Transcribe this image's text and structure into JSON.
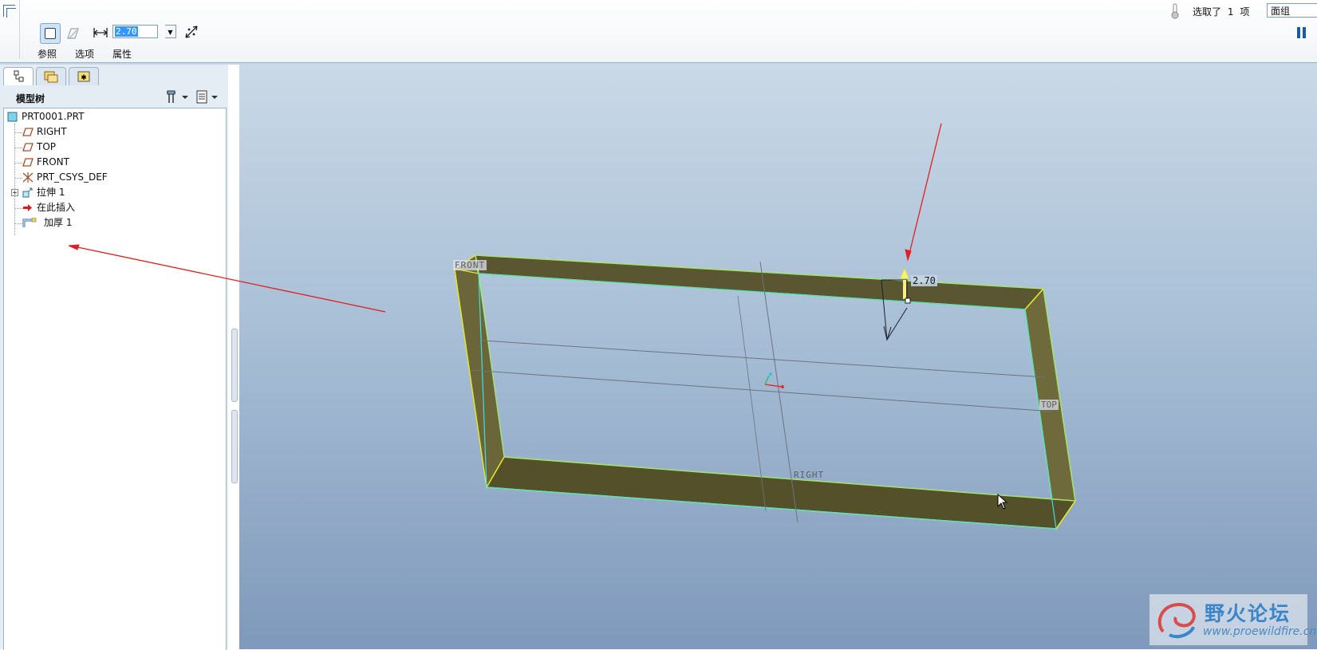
{
  "dashboard": {
    "thickness_value": "2.70",
    "tabs": [
      "参照",
      "选项",
      "属性"
    ],
    "status_prefix": "选取了",
    "status_count": "1",
    "status_suffix": "项",
    "filter_value": "面组"
  },
  "navigator": {
    "model_tree_title": "模型树",
    "items": [
      {
        "label": "PRT0001.PRT",
        "icon": "part-icon"
      },
      {
        "label": "RIGHT",
        "icon": "datum-plane-icon"
      },
      {
        "label": "TOP",
        "icon": "datum-plane-icon"
      },
      {
        "label": "FRONT",
        "icon": "datum-plane-icon"
      },
      {
        "label": "PRT_CSYS_DEF",
        "icon": "csys-icon"
      },
      {
        "label": "拉伸 1",
        "icon": "extrude-icon"
      },
      {
        "label": "在此插入",
        "icon": "insert-here-arrow-icon"
      },
      {
        "label": "加厚 1",
        "icon": "thicken-icon"
      }
    ]
  },
  "viewport": {
    "datum_labels": {
      "front": "FRONT",
      "top": "TOP",
      "right": "RIGHT"
    },
    "thickness_dimension": "2.70"
  },
  "watermark": {
    "title": "野火论坛",
    "url": "www.proewildfire.cn"
  },
  "colors": {
    "background_top": "#cad9e7",
    "background_bottom": "#7f99bb",
    "geometry_fill": "#5b5632",
    "geometry_edge": "#e8e82a",
    "annotation_arrow": "#e02020",
    "highlight_edge": "#3ee0e0"
  }
}
